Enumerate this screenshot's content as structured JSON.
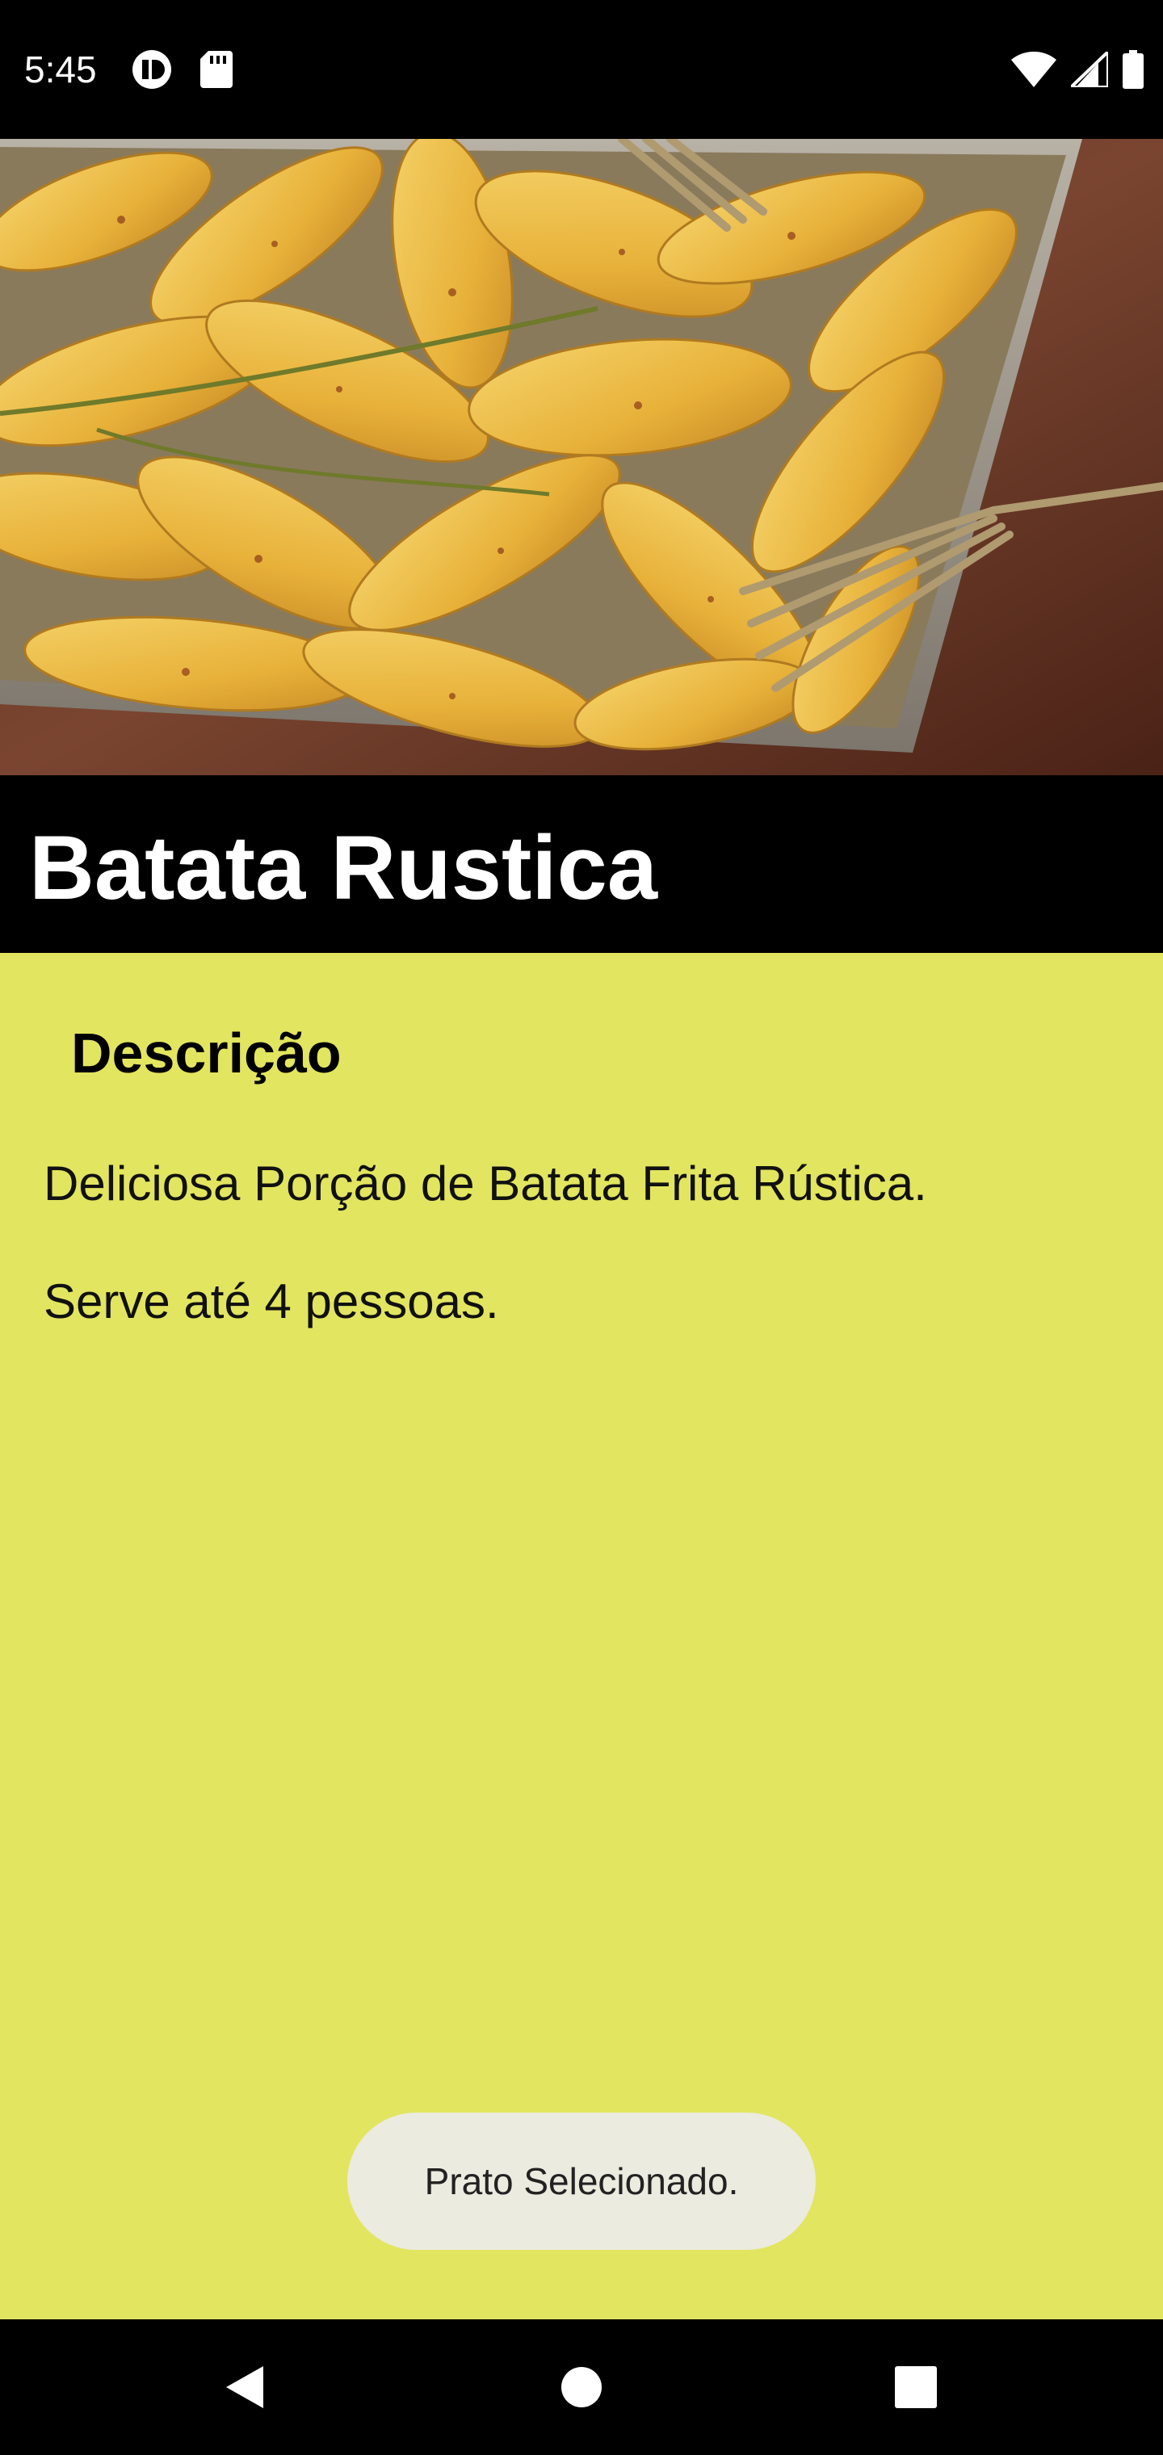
{
  "status_bar": {
    "time": "5:45",
    "left_icons": [
      "media-icon",
      "sd-card-icon"
    ],
    "right_icons": [
      "wifi-icon",
      "signal-icon",
      "battery-icon"
    ]
  },
  "hero": {
    "image_desc_icon": "food-photo"
  },
  "dish": {
    "title": "Batata Rustica"
  },
  "description": {
    "heading": "Descrição",
    "line1": "Deliciosa Porção de Batata Frita Rústica.",
    "line2": "Serve até 4 pessoas."
  },
  "toast": {
    "message": "Prato Selecionado."
  },
  "nav_bar": {
    "buttons": [
      "back-icon",
      "home-icon",
      "recents-icon"
    ]
  },
  "colors": {
    "content_background": "#e2e55f",
    "title_band": "#000000",
    "toast_background": "#ebebdf"
  }
}
